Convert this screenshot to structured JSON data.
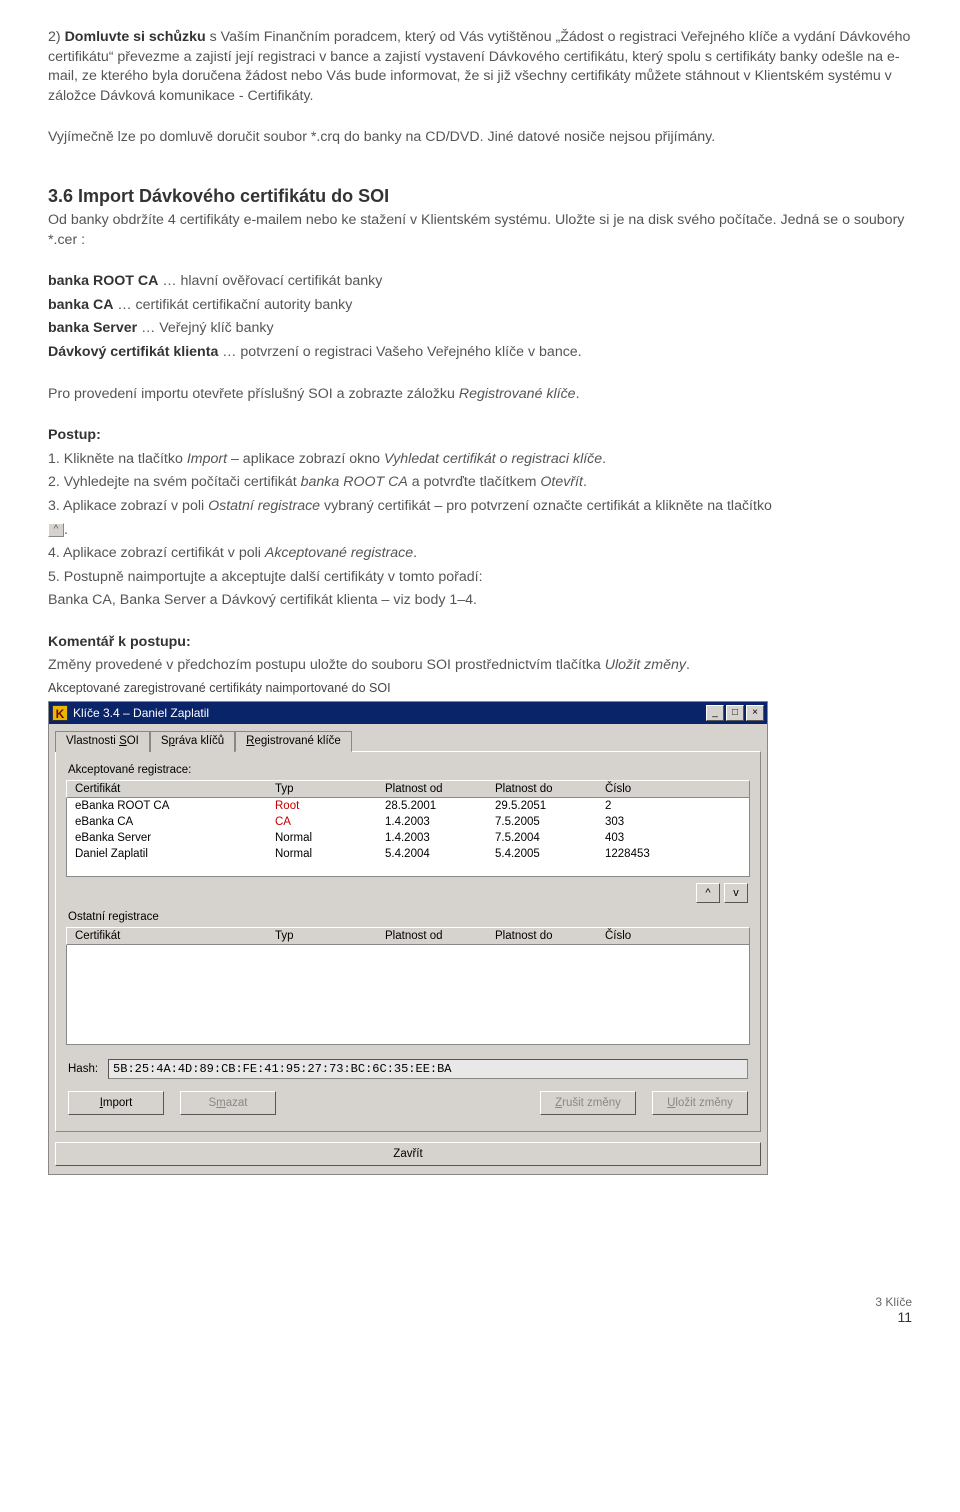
{
  "para1_lead": "2) ",
  "para1_bold": "Domluvte si schůzku",
  "para1_rest": " s Vaším Finančním poradcem, který od Vás vytištěnou „Žádost o registraci Veřejného klíče a vydání Dávkového certifikátu“ převezme a zajistí její registraci v bance a zajistí vystavení Dávkového certifikátu, který spolu s certifikáty banky odešle na e-mail, ze kterého byla doručena žádost nebo Vás bude informovat, že si již všechny certifikáty můžete stáhnout v Klientském systému v záložce Dávková komunikace - Certifikáty.",
  "para2": "Vyjímečně lze po domluvě doručit soubor *.crq do banky na CD/DVD. Jiné datové nosiče nejsou přijímány.",
  "h2": "3.6 Import Dávkového certifikátu do SOI",
  "p3": "Od banky obdržíte 4 certifikáty e-mailem nebo ke stažení v Klientském systému. Uložte si je na disk svého počítače. Jedná se o soubory *.cer :",
  "c1b": "banka ROOT CA",
  "c1r": " … hlavní ověřovací certifikát banky",
  "c2b": "banka CA",
  "c2r": " … certifikát certifikační autority banky",
  "c3b": "banka Server",
  "c3r": " … Veřejný klíč banky",
  "c4b": "Dávkový certifikát klienta",
  "c4r": " … potvrzení o registraci Vašeho Veřejného klíče v bance.",
  "p4a": "Pro provedení importu otevřete příslušný SOI a zobrazte záložku ",
  "p4i": "Registrované klíče",
  "p4b": ".",
  "postup": "Postup:",
  "s1a": "1. Klikněte na tlačítko ",
  "s1i": "Import",
  "s1b": " – aplikace zobrazí okno ",
  "s1i2": "Vyhledat certifikát o registraci klíče",
  "s1c": ".",
  "s2a": "2. Vyhledejte na svém počítači certifikát ",
  "s2i": "banka ROOT CA",
  "s2b": " a potvrďte tlačítkem ",
  "s2i2": "Otevřít",
  "s2c": ".",
  "s3a": "3. Aplikace zobrazí v poli ",
  "s3i": "Ostatní registrace",
  "s3b": " vybraný certifikát – pro potvrzení označte certifikát a klikněte na tlačítko ",
  "s3icon": "^",
  "s3c": ".",
  "s4a": "4. Aplikace zobrazí certifikát v poli ",
  "s4i": "Akceptované registrace",
  "s4b": ".",
  "s5": "5. Postupně naimportujte a akceptujte další certifikáty v tomto pořadí:",
  "s5b": "Banka CA, Banka Server a Dávkový certifikát klienta – viz body 1–4.",
  "kom": "Komentář k postupu:",
  "koma": "Změny provedené v předchozím postupu uložte do souboru SOI prostřednictvím tlačítka ",
  "komi": "Uložit změny",
  "komb": ".",
  "caption": "Akceptované zaregistrované certifikáty naimportované do SOI",
  "win": {
    "title": "Klíče 3.4 – Daniel Zaplatil",
    "tabs": [
      "Vlastnosti SOI",
      "Správa klíčů",
      "Registrované klíče"
    ],
    "tabU": [
      "S",
      "p",
      "R"
    ],
    "grp1": "Akceptované registrace:",
    "hdr": {
      "c": "Certifikát",
      "t": "Typ",
      "p1": "Platnost od",
      "p2": "Platnost do",
      "n": "Číslo"
    },
    "rows": [
      {
        "c": "eBanka ROOT CA",
        "t": "Root",
        "p1": "28.5.2001",
        "p2": "29.5.2051",
        "n": "2",
        "tred": true
      },
      {
        "c": "eBanka CA",
        "t": "CA",
        "p1": "1.4.2003",
        "p2": "7.5.2005",
        "n": "303",
        "tred": true
      },
      {
        "c": "eBanka Server",
        "t": "Normal",
        "p1": "1.4.2003",
        "p2": "7.5.2004",
        "n": "403",
        "tred": false
      },
      {
        "c": "Daniel Zaplatil",
        "t": "Normal",
        "p1": "5.4.2004",
        "p2": "5.4.2005",
        "n": "1228453",
        "tred": false
      }
    ],
    "up": "^",
    "down": "v",
    "grp2": "Ostatní registrace",
    "hashLabel": "Hash:",
    "hash": "5B:25:4A:4D:89:CB:FE:41:95:27:73:BC:6C:35:EE:BA",
    "bImport": "Import",
    "bImportU": "I",
    "bSmazat": "Smazat",
    "bSmazatU": "m",
    "bZrusit": "Zrušit změny",
    "bZrusitU": "Z",
    "bUlozit": "Uložit změny",
    "bUlozitU": "U",
    "bZavrit": "Zavřít"
  },
  "footer": {
    "sec": "3 Klíče",
    "page": "11"
  }
}
